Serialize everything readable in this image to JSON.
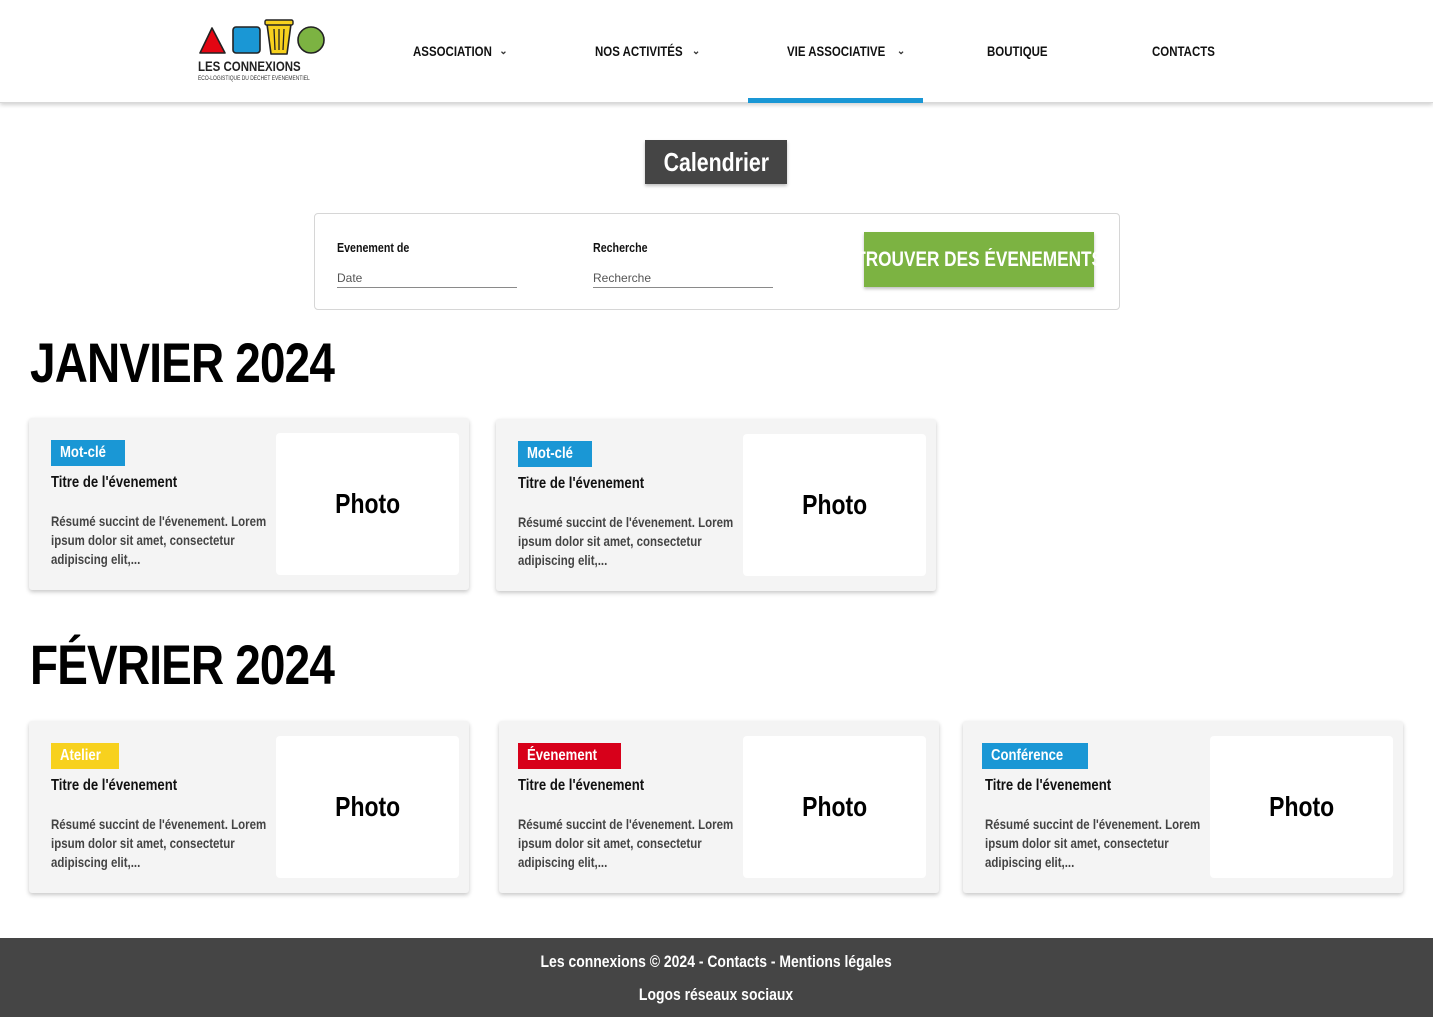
{
  "logo": {
    "name": "LES CONNEXIONS",
    "tagline": "ÉCO-LOGISTIQUE DU DÉCHET ÉVÉNEMENTIEL",
    "colors": [
      "#e30613",
      "#1a97d5",
      "#f7d11e",
      "#7cb342"
    ]
  },
  "nav": {
    "items": [
      {
        "label": "ASSOCIATION",
        "has_dropdown": true
      },
      {
        "label": "NOS ACTIVITÉS",
        "has_dropdown": true
      },
      {
        "label": "VIE ASSOCIATIVE",
        "has_dropdown": true,
        "active": true
      },
      {
        "label": "BOUTIQUE",
        "has_dropdown": false
      },
      {
        "label": "CONTACTS",
        "has_dropdown": false
      }
    ],
    "chevron_icon": "chevron-down-icon",
    "active_color": "#1a97d5"
  },
  "page_title": "Calendrier",
  "search": {
    "date_label": "Evenement de",
    "date_placeholder": "Date",
    "keyword_label": "Recherche",
    "keyword_placeholder": "Recherche",
    "button_label": "TROUVER DES ÉVENEMENTS",
    "button_color": "#7cb342"
  },
  "months": [
    {
      "heading": "JANVIER 2024",
      "events": [
        {
          "tag": "Mot-clé",
          "tag_color": "#1a97d5",
          "title": "Titre de l'évenement",
          "summary": "Résumé succint de l'évenement. Lorem ipsum dolor sit amet, consectetur adipiscing elit,...",
          "photo": "Photo"
        },
        {
          "tag": "Mot-clé",
          "tag_color": "#1a97d5",
          "title": "Titre de l'évenement",
          "summary": "Résumé succint de l'évenement. Lorem ipsum dolor sit amet, consectetur adipiscing elit,...",
          "photo": "Photo"
        }
      ]
    },
    {
      "heading": "FÉVRIER 2024",
      "events": [
        {
          "tag": "Atelier",
          "tag_color": "#f7d11e",
          "title": "Titre de l'évenement",
          "summary": "Résumé succint de l'évenement. Lorem ipsum dolor sit amet, consectetur adipiscing elit,...",
          "photo": "Photo"
        },
        {
          "tag": "Évenement",
          "tag_color": "#d7001a",
          "title": "Titre de l'évenement",
          "summary": "Résumé succint de l'évenement. Lorem ipsum dolor sit amet, consectetur adipiscing elit,...",
          "photo": "Photo"
        },
        {
          "tag": "Conférence",
          "tag_color": "#1a97d5",
          "title": "Titre de l'évenement",
          "summary": "Résumé succint de l'évenement. Lorem ipsum dolor sit amet, consectetur adipiscing elit,...",
          "photo": "Photo"
        }
      ]
    }
  ],
  "footer": {
    "brand": "Les connexions",
    "copyright": "© 2024",
    "separator": "-",
    "contacts_link": "Contacts",
    "legal_link": "Mentions légales",
    "social": "Logos réseaux sociaux",
    "background": "#454545"
  }
}
